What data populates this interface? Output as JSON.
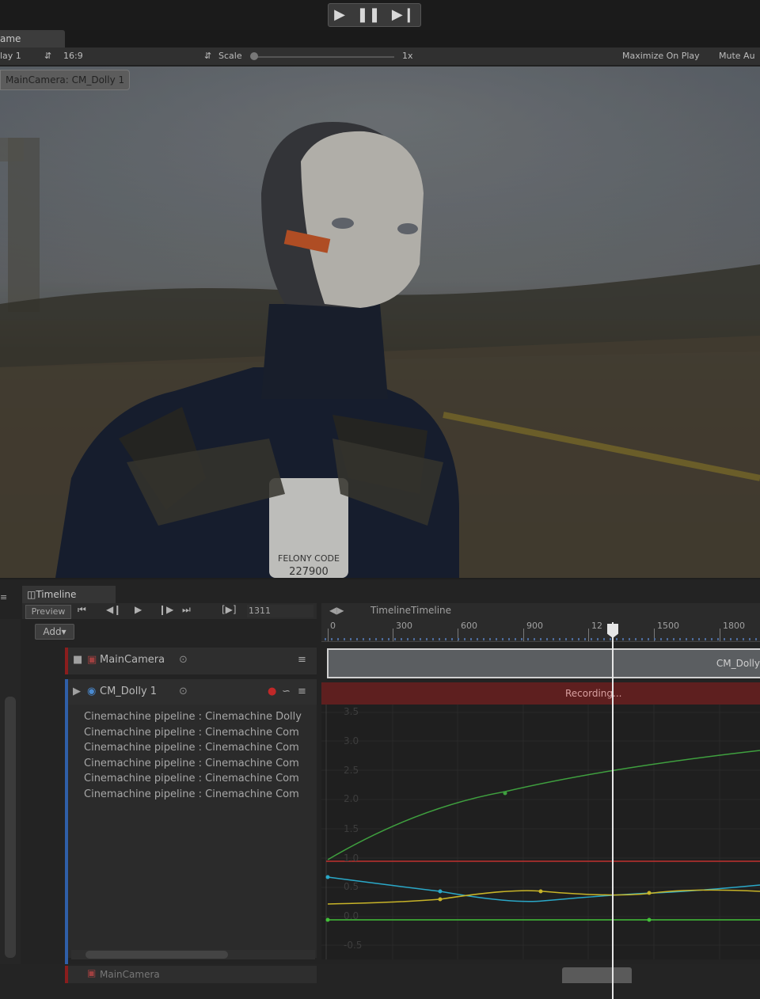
{
  "game_view": {
    "tab_label": "ame",
    "display": "lay 1",
    "aspect": "16:9",
    "scale_label": "Scale",
    "scale_value": "1x",
    "maximize_on_play": "Maximize On Play",
    "mute_audio": "Mute Au",
    "camera_label": "MainCamera: CM_Dolly 1",
    "scene_badge_line1": "FELONY CODE",
    "scene_badge_line2": "227900"
  },
  "timeline": {
    "tab_label": "Timeline",
    "preview_label": "Preview",
    "frame_value": "1311",
    "add_label": "Add",
    "asset_name": "TimelineTimeline",
    "ruler_labels": [
      "0",
      "300",
      "600",
      "900",
      "12",
      "1500",
      "1800"
    ],
    "tracks": [
      {
        "name": "MainCamera",
        "clip_label": "CM_Dolly"
      },
      {
        "name": "CM_Dolly 1",
        "recording_label": "Recording..."
      }
    ],
    "pipeline_rows": [
      "Cinemachine pipeline : Cinemachine Dolly",
      "Cinemachine pipeline : Cinemachine Com",
      "Cinemachine pipeline : Cinemachine Com",
      "Cinemachine pipeline : Cinemachine Com",
      "Cinemachine pipeline : Cinemachine Com",
      "Cinemachine pipeline : Cinemachine Com"
    ],
    "curve_y_labels": [
      "3.5",
      "3.0",
      "2.5",
      "2.0",
      "1.5",
      "1.0",
      "0.5",
      "0.0",
      "-0.5"
    ],
    "bottom_track_name": "MainCamera",
    "curve_colors": {
      "green": "#3fa03f",
      "red": "#c0302e",
      "cyan": "#2aa8c8",
      "yellow": "#c8b428",
      "lime": "#42c038"
    }
  },
  "colors": {
    "track_red_accent": "#8a1d1d",
    "track_blue_accent": "#2f5fa8",
    "playhead": "#e6e6e6"
  }
}
